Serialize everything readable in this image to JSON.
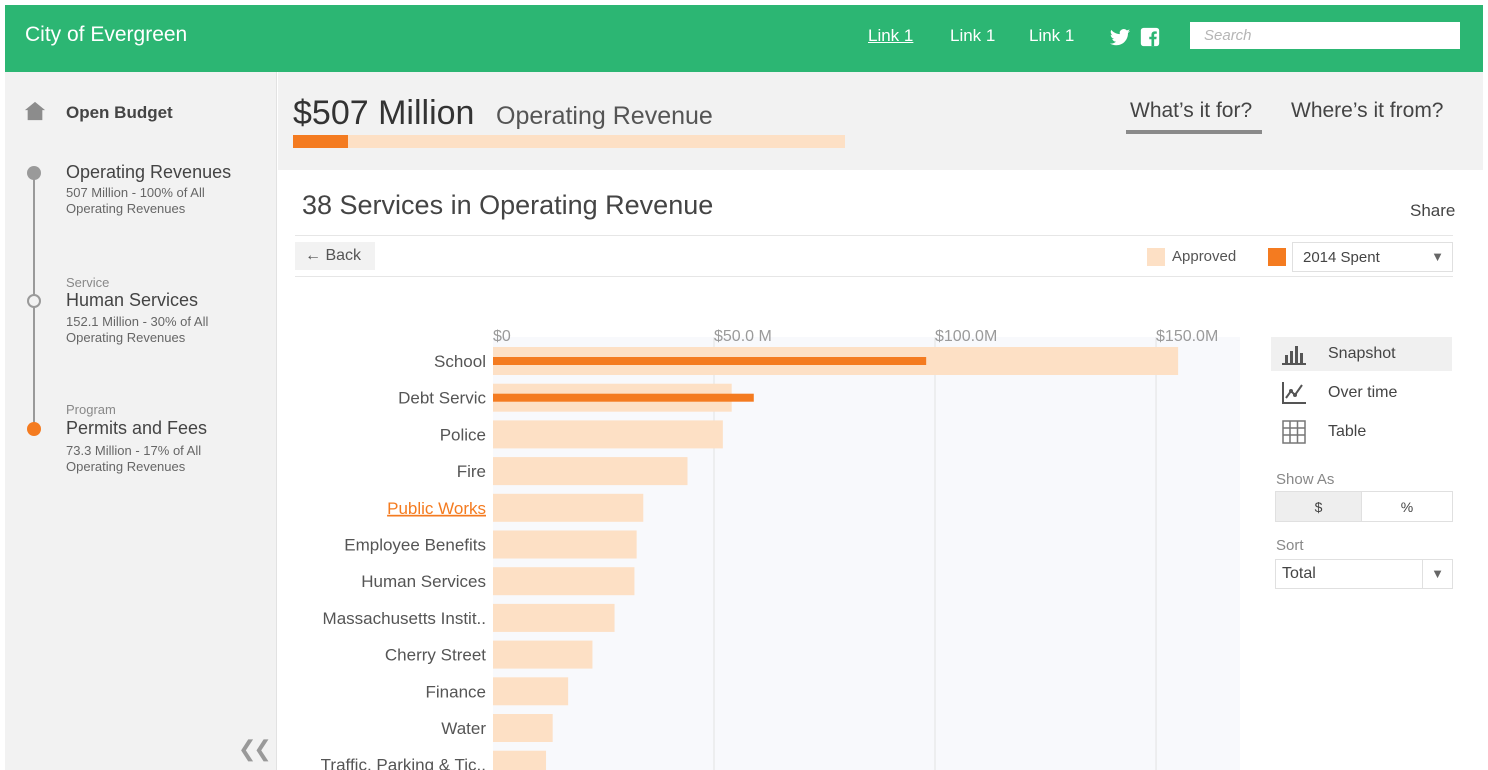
{
  "header": {
    "brand": "City of Evergreen",
    "links": [
      "Link 1",
      "Link 1",
      "Link 1"
    ],
    "social": [
      "twitter-icon",
      "facebook-icon"
    ],
    "search_placeholder": "Search"
  },
  "sidebar": {
    "home_label": "Open Budget",
    "levels": [
      {
        "level": "",
        "name": "Operating Revenues",
        "desc": "507 Million - 100% of All Operating Revenues",
        "dot": "filled-grey"
      },
      {
        "level": "Service",
        "name": "Human Services",
        "desc": "152.1 Million - 30% of All Operating Revenues",
        "dot": "ring"
      },
      {
        "level": "Program",
        "name": "Permits and Fees",
        "desc": "73.3 Million - 17% of All Operating Revenues",
        "dot": "orange"
      }
    ],
    "collapse_glyph": "❮❮"
  },
  "summary": {
    "amount": "$507 Million",
    "label": "Operating Revenue",
    "progress_fraction": 0.1,
    "tabs": [
      "What’s it for?",
      "Where’s it from?"
    ],
    "active_tab": 0
  },
  "content": {
    "title": "38 Services in Operating Revenue",
    "share": "Share",
    "back": "← Back",
    "legend_approved": "Approved",
    "legend_spent_select": "2014 Spent"
  },
  "colors": {
    "brand_green": "#2cb673",
    "approved": "#fde0c5",
    "spent": "#f47b20",
    "link_orange": "#f47b20"
  },
  "panel": {
    "views": [
      {
        "label": "Snapshot",
        "icon": "bar-chart-icon"
      },
      {
        "label": "Over time",
        "icon": "line-chart-icon"
      },
      {
        "label": "Table",
        "icon": "table-grid-icon"
      }
    ],
    "active_view": 0,
    "show_as_label": "Show As",
    "show_as_options": [
      "$",
      "%"
    ],
    "show_as_selected": 0,
    "sort_label": "Sort",
    "sort_value": "Total"
  },
  "chart_data": {
    "type": "bar",
    "orientation": "horizontal",
    "x_ticks": [
      "$0",
      "$50.0 M",
      "$100.0M",
      "$150.0M"
    ],
    "x_tick_values": [
      0,
      50,
      100,
      150
    ],
    "xlim": [
      0,
      169
    ],
    "categories": [
      "School",
      "Debt Servic",
      "Police",
      "Fire",
      "Public Works",
      "Employee Benefits",
      "Human Services",
      "Massachusetts Instit..",
      "Cherry Street",
      "Finance",
      "Water",
      "Traffic, Parking & Tic.."
    ],
    "highlighted_category": "Public Works",
    "series": [
      {
        "name": "Approved",
        "values": [
          155,
          54,
          52,
          44,
          34,
          32.5,
          32,
          27.5,
          22.5,
          17,
          13.5,
          12
        ]
      },
      {
        "name": "2014 Spent",
        "values": [
          98,
          59,
          null,
          null,
          null,
          null,
          null,
          null,
          null,
          null,
          null,
          null
        ]
      }
    ],
    "grid": true
  }
}
